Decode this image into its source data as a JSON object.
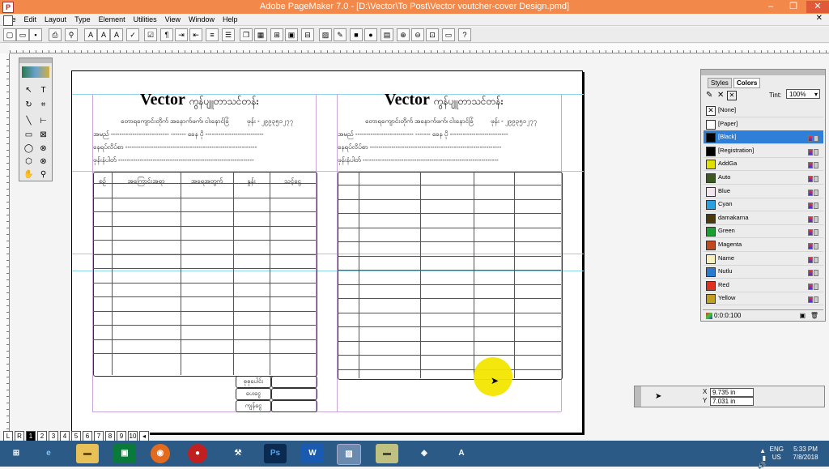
{
  "window": {
    "title": "Adobe PageMaker 7.0 - [D:\\Vector\\To Post\\Vector voutcher-cover Design.pmd]"
  },
  "menu": [
    "File",
    "Edit",
    "Layout",
    "Type",
    "Element",
    "Utilities",
    "View",
    "Window",
    "Help"
  ],
  "voucher": {
    "title": "Vector",
    "title_suffix": "ကွန်ပျူတာသင်တန်း",
    "subtitle": "တောရကျောင်းတိုက် အနောက်ဖက်၊ ငါးနောင်ခြံ",
    "phone": "ဖုန်း - ၂၉၉၃၅၁၂၇၇",
    "field_name": "အမည်",
    "field_name_suffix": "ခေန ပို",
    "field_address": "နေရပ်လိပ်စာ",
    "field_phone": "ဖုန်းနံပါတ်",
    "columns": [
      "စဉ်",
      "အကြောင်းအရာ",
      "အရေအတွက်",
      "နှုန်း",
      "သင့်ငွေ"
    ],
    "totals": [
      "စုစုပေါင်း",
      "ပေးငွေ",
      "ကျန်ငွေ"
    ]
  },
  "colors_panel": {
    "tabs": [
      "Styles",
      "Colors"
    ],
    "tint_label": "Tint:",
    "tint_value": "100%",
    "items": [
      {
        "name": "[None]",
        "color": "#ffffff"
      },
      {
        "name": "[Paper]",
        "color": "#ffffff"
      },
      {
        "name": "[Black]",
        "color": "#000000"
      },
      {
        "name": "[Registration]",
        "color": "#000000"
      },
      {
        "name": "AddGa",
        "color": "#e0e000"
      },
      {
        "name": "Auto",
        "color": "#3a5a20"
      },
      {
        "name": "Blue",
        "color": "#f2e6f0"
      },
      {
        "name": "Cyan",
        "color": "#2ba0e0"
      },
      {
        "name": "damakarna",
        "color": "#4a3a10"
      },
      {
        "name": "Green",
        "color": "#1aa030"
      },
      {
        "name": "Magenta",
        "color": "#c04a20"
      },
      {
        "name": "Name",
        "color": "#f6f0c0"
      },
      {
        "name": "Nutlu",
        "color": "#2a7ad0"
      },
      {
        "name": "Red",
        "color": "#e03020"
      },
      {
        "name": "Yellow",
        "color": "#c0a020"
      }
    ],
    "footer_value": "0:0:0:100"
  },
  "control_palette": {
    "x_label": "X",
    "x_value": "9.735 in",
    "y_label": "Y",
    "y_value": "7.031 in"
  },
  "page_tabs": [
    "L",
    "R",
    "1",
    "2",
    "3",
    "4",
    "5",
    "6",
    "7",
    "8",
    "9",
    "10"
  ],
  "tray": {
    "lang": "ENG",
    "region": "US",
    "time": "5:33 PM",
    "date": "7/8/2018"
  }
}
